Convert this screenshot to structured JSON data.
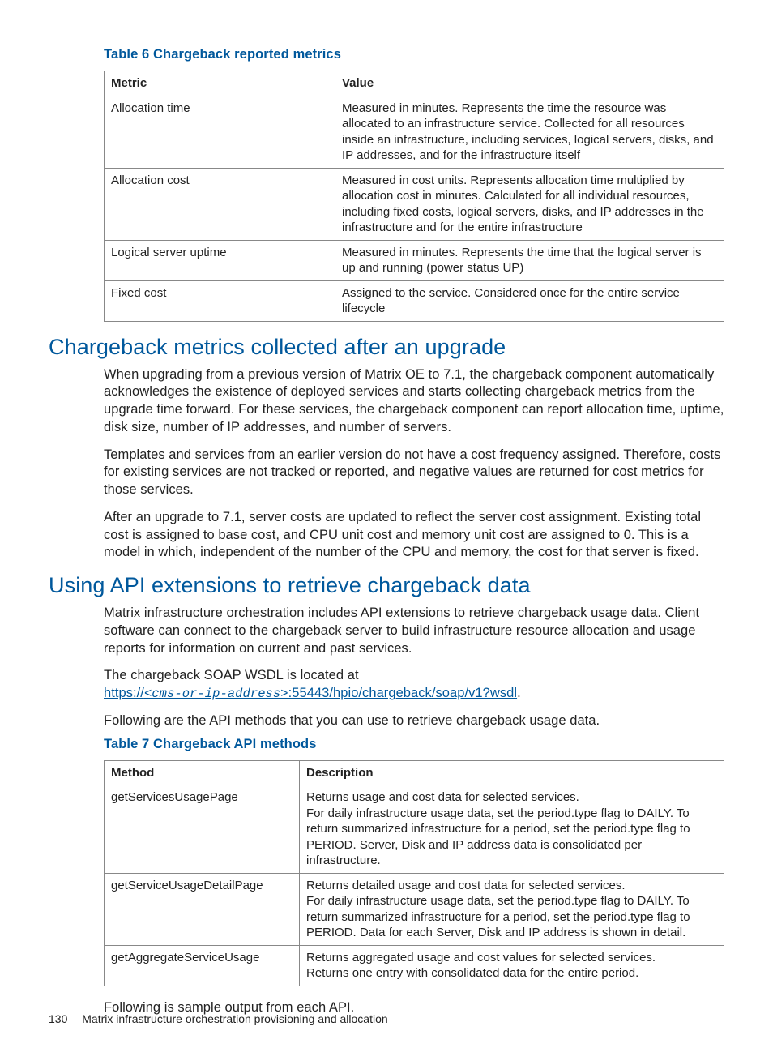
{
  "table6": {
    "caption": "Table 6 Chargeback reported metrics",
    "headers": [
      "Metric",
      "Value"
    ],
    "rows": [
      {
        "metric": "Allocation time",
        "value": "Measured in minutes. Represents the time the resource was allocated to an infrastructure service. Collected for all resources inside an infrastructure, including services, logical servers, disks, and IP addresses, and for the infrastructure itself"
      },
      {
        "metric": "Allocation cost",
        "value": "Measured in cost units. Represents allocation time multiplied by allocation cost in minutes. Calculated for all individual resources, including fixed costs, logical servers, disks, and IP addresses in the infrastructure and for the entire infrastructure"
      },
      {
        "metric": "Logical server uptime",
        "value": "Measured in minutes. Represents the time that the logical server is up and running (power status UP)"
      },
      {
        "metric": "Fixed cost",
        "value": "Assigned to the service. Considered once for the entire service lifecycle"
      }
    ]
  },
  "section1": {
    "heading": "Chargeback metrics collected after an upgrade",
    "paragraphs": [
      "When upgrading from a previous version of Matrix OE to 7.1, the chargeback component automatically acknowledges the existence of deployed services and starts collecting chargeback metrics from the upgrade time forward. For these services, the chargeback component can report allocation time, uptime, disk size, number of IP addresses, and number of servers.",
      "Templates and services from an earlier version do not have a cost frequency assigned. Therefore, costs for existing services are not tracked or reported, and negative values are returned for cost metrics for those services.",
      "After an upgrade to 7.1, server costs are updated to reflect the server cost assignment. Existing total cost is assigned to base cost, and CPU unit cost and memory unit cost are assigned to 0. This is a model in which, independent of the number of the CPU and memory, the cost for that server is fixed."
    ]
  },
  "section2": {
    "heading": "Using API extensions to retrieve chargeback data",
    "p1": "Matrix infrastructure orchestration includes API extensions to retrieve chargeback usage data. Client software can connect to the chargeback server to build infrastructure resource allocation and usage reports for information on current and past services.",
    "p2a": "The chargeback SOAP WSDL is located at",
    "link_pre": "https://",
    "link_mid": "<cms-or-ip-address>",
    "link_post": ":55443/hpio/chargeback/soap/v1?wsdl",
    "p3": "Following are the API methods that you can use to retrieve chargeback usage data."
  },
  "table7": {
    "caption": "Table 7 Chargeback API methods",
    "headers": [
      "Method",
      "Description"
    ],
    "rows": [
      {
        "method": "getServicesUsagePage",
        "description": "Returns usage and cost data for selected services.\nFor daily infrastructure usage data, set the period.type flag to DAILY. To return summarized infrastructure for a period, set the period.type flag to PERIOD. Server, Disk and IP address data is consolidated per infrastructure."
      },
      {
        "method": "getServiceUsageDetailPage",
        "description": "Returns detailed usage and cost data for selected services.\nFor daily infrastructure usage data, set the period.type flag to DAILY. To return summarized infrastructure for a period, set the period.type flag to PERIOD. Data for each Server, Disk and IP address is shown in detail."
      },
      {
        "method": "getAggregateServiceUsage",
        "description": "Returns aggregated usage and cost values for selected services.\nReturns one entry with consolidated data for the entire period."
      }
    ]
  },
  "closing": "Following is sample output from each API.",
  "footer": {
    "page_number": "130",
    "running_title": "Matrix infrastructure orchestration provisioning and allocation"
  }
}
